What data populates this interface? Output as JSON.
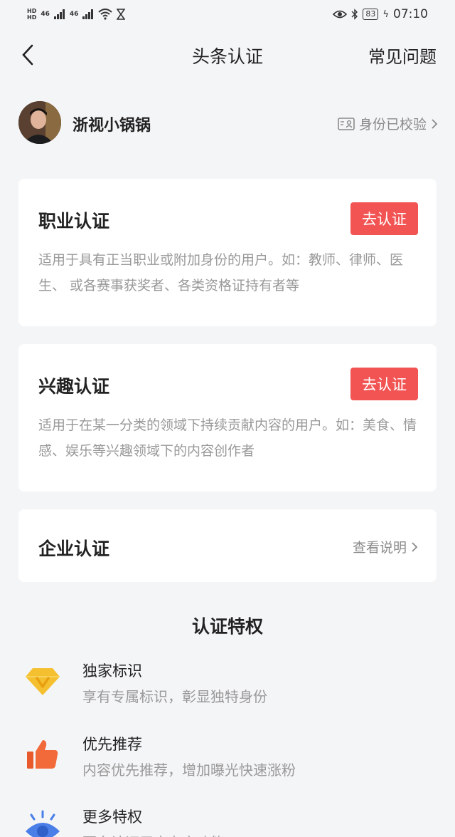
{
  "status_bar": {
    "hd1": "HD",
    "hd2": "HD",
    "sig1": "46",
    "sig2": "46",
    "battery": "83",
    "time": "07:10"
  },
  "header": {
    "title": "头条认证",
    "faq_label": "常见问题"
  },
  "profile": {
    "username": "浙视小锅锅",
    "verify_status": "身份已校验"
  },
  "cards": {
    "career": {
      "title": "职业认证",
      "button": "去认证",
      "description": "适用于具有正当职业或附加身份的用户。如：教师、律师、医生、 或各赛事获奖者、各类资格证持有者等"
    },
    "interest": {
      "title": "兴趣认证",
      "button": "去认证",
      "description": "适用于在某一分类的领域下持续贡献内容的用户。如：美食、情感、娱乐等兴趣领域下的内容创作者"
    },
    "enterprise": {
      "title": "企业认证",
      "link": "查看说明"
    }
  },
  "perks": {
    "title": "认证特权",
    "items": [
      {
        "title": "独家标识",
        "desc": "享有专属标识，彰显独特身份",
        "icon": "diamond-v-icon"
      },
      {
        "title": "优先推荐",
        "desc": "内容优先推荐，增加曝光快速涨粉",
        "icon": "thumbs-up-icon"
      },
      {
        "title": "更多特权",
        "desc": "更多认证用户专享功能",
        "icon": "eye-icon"
      }
    ]
  },
  "colors": {
    "accent": "#f25353",
    "background": "#f4f5f7",
    "gold": "#f5c030",
    "orange": "#f26a3a",
    "blue": "#4a7fe8"
  }
}
